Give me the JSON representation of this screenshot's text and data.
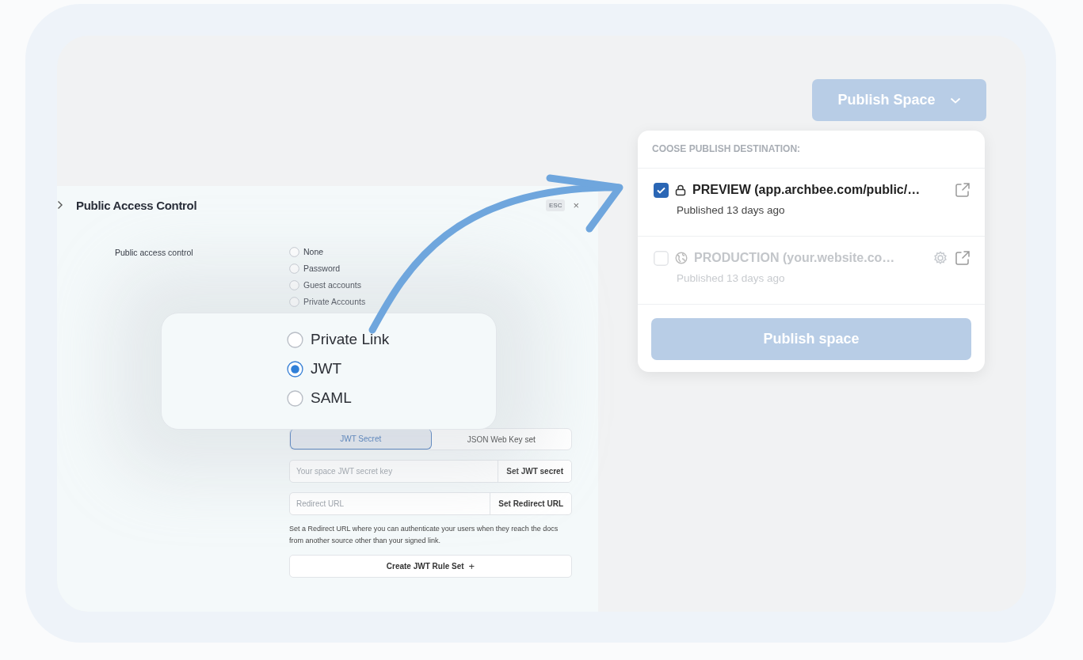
{
  "access_panel": {
    "title": "Public Access Control",
    "esc_key": "ESC",
    "close": "×",
    "field_label": "Public access control",
    "options": [
      {
        "label": "None",
        "selected": false
      },
      {
        "label": "Password",
        "selected": false
      },
      {
        "label": "Guest accounts",
        "selected": false
      },
      {
        "label": "Private Accounts",
        "selected": false
      }
    ],
    "auth_tabs": [
      {
        "label": "JWT Secret",
        "selected": true
      },
      {
        "label": "JSON Web Key set",
        "selected": false
      }
    ],
    "secret_field": {
      "placeholder": "Your space JWT secret key",
      "button": "Set JWT secret"
    },
    "redirect_field": {
      "placeholder": "Redirect URL",
      "button": "Set Redirect URL"
    },
    "help": "Set a Redirect URL where you can authenticate your users when they reach the docs from another source other than your signed link.",
    "create_button": "Create JWT Rule Set",
    "create_icon": "+"
  },
  "zoom_card": {
    "options": [
      {
        "label": "Private Link",
        "selected": false
      },
      {
        "label": "JWT",
        "selected": true
      },
      {
        "label": "SAML",
        "selected": false
      }
    ]
  },
  "publish": {
    "button": "Publish Space",
    "heading": "COOSE PUBLISH DESTINATION:",
    "destinations": [
      {
        "kind": "preview",
        "title": "PREVIEW (app.archbee.com/public/…",
        "status": "Published 13 days ago",
        "checked": true,
        "disabled": false
      },
      {
        "kind": "production",
        "title": "PRODUCTION (your.website.co…",
        "status": "Published 13 days ago",
        "checked": false,
        "disabled": true
      }
    ],
    "submit": "Publish space"
  }
}
